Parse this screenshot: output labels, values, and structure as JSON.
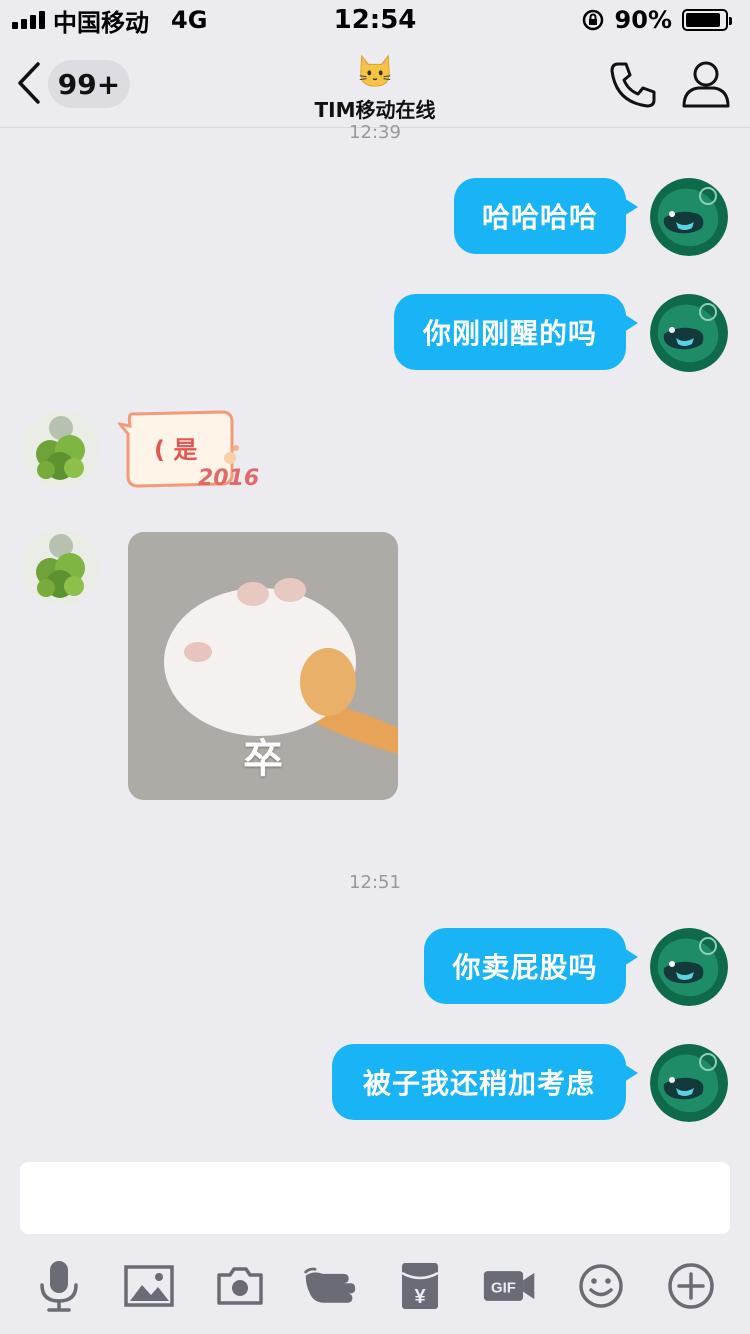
{
  "status_bar": {
    "carrier": "中国移动",
    "network": "4G",
    "time": "12:54",
    "battery": "90%",
    "battery_level": 0.9
  },
  "header": {
    "unread_count": "99+",
    "title": "TIM移动在线"
  },
  "timestamps": [
    "12:39",
    "12:51"
  ],
  "messages": {
    "m1": "哈哈哈哈",
    "m2": "你刚刚醒的吗",
    "m3_sticker": "( 是",
    "m3_sticker_year": "2016",
    "m4_caption": "卒",
    "m5": "你卖屁股吗",
    "m6": "被子我还稍加考虑"
  },
  "input": {
    "value": "",
    "placeholder": ""
  },
  "toolbar": {
    "icons": [
      "microphone-icon",
      "image-icon",
      "camera-icon",
      "poke-icon",
      "red-packet-icon",
      "gif-icon",
      "emoji-icon",
      "plus-icon"
    ],
    "gif_label": "GIF",
    "red_packet_label": "¥"
  },
  "colors": {
    "bubble": "#18b4f5",
    "background": "#ebebf0",
    "icon": "#6b6b75"
  }
}
